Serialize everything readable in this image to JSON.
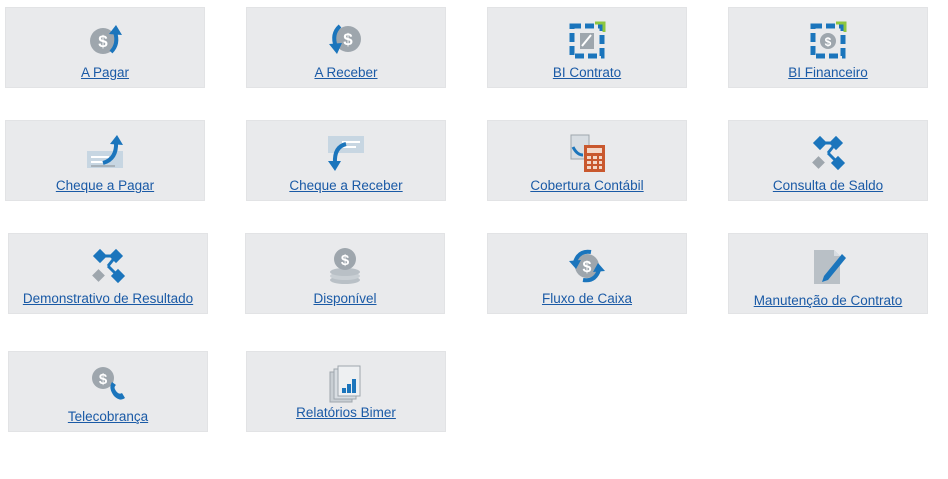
{
  "tiles": [
    {
      "label": "A Pagar",
      "icon": "dollar-arrow-up-icon"
    },
    {
      "label": "A Receber",
      "icon": "dollar-arrow-down-icon"
    },
    {
      "label": "BI Contrato",
      "icon": "bi-contract-icon"
    },
    {
      "label": "BI Financeiro",
      "icon": "bi-finance-icon"
    },
    {
      "label": "Cheque a Pagar",
      "icon": "cheque-arrow-up-icon"
    },
    {
      "label": "Cheque a Receber",
      "icon": "cheque-arrow-down-icon"
    },
    {
      "label": "Cobertura Contábil",
      "icon": "calculator-icon"
    },
    {
      "label": "Consulta de Saldo",
      "icon": "network-nodes-icon"
    },
    {
      "label": "Demonstrativo de Resultado",
      "icon": "network-nodes-icon"
    },
    {
      "label": "Disponível",
      "icon": "coin-stack-icon"
    },
    {
      "label": "Fluxo de Caixa",
      "icon": "dollar-cycle-icon"
    },
    {
      "label": "Manutenção de Contrato",
      "icon": "document-pencil-icon"
    },
    {
      "label": "Telecobrança",
      "icon": "dollar-phone-icon"
    },
    {
      "label": "Relatórios Bimer",
      "icon": "reports-icon"
    }
  ],
  "colors": {
    "tile_bg": "#e9eaec",
    "link": "#1a5aa6",
    "icon_blue": "#1b75bc",
    "icon_gray": "#9ea6ad",
    "icon_green": "#8dc63f",
    "icon_orange": "#c9582e"
  }
}
